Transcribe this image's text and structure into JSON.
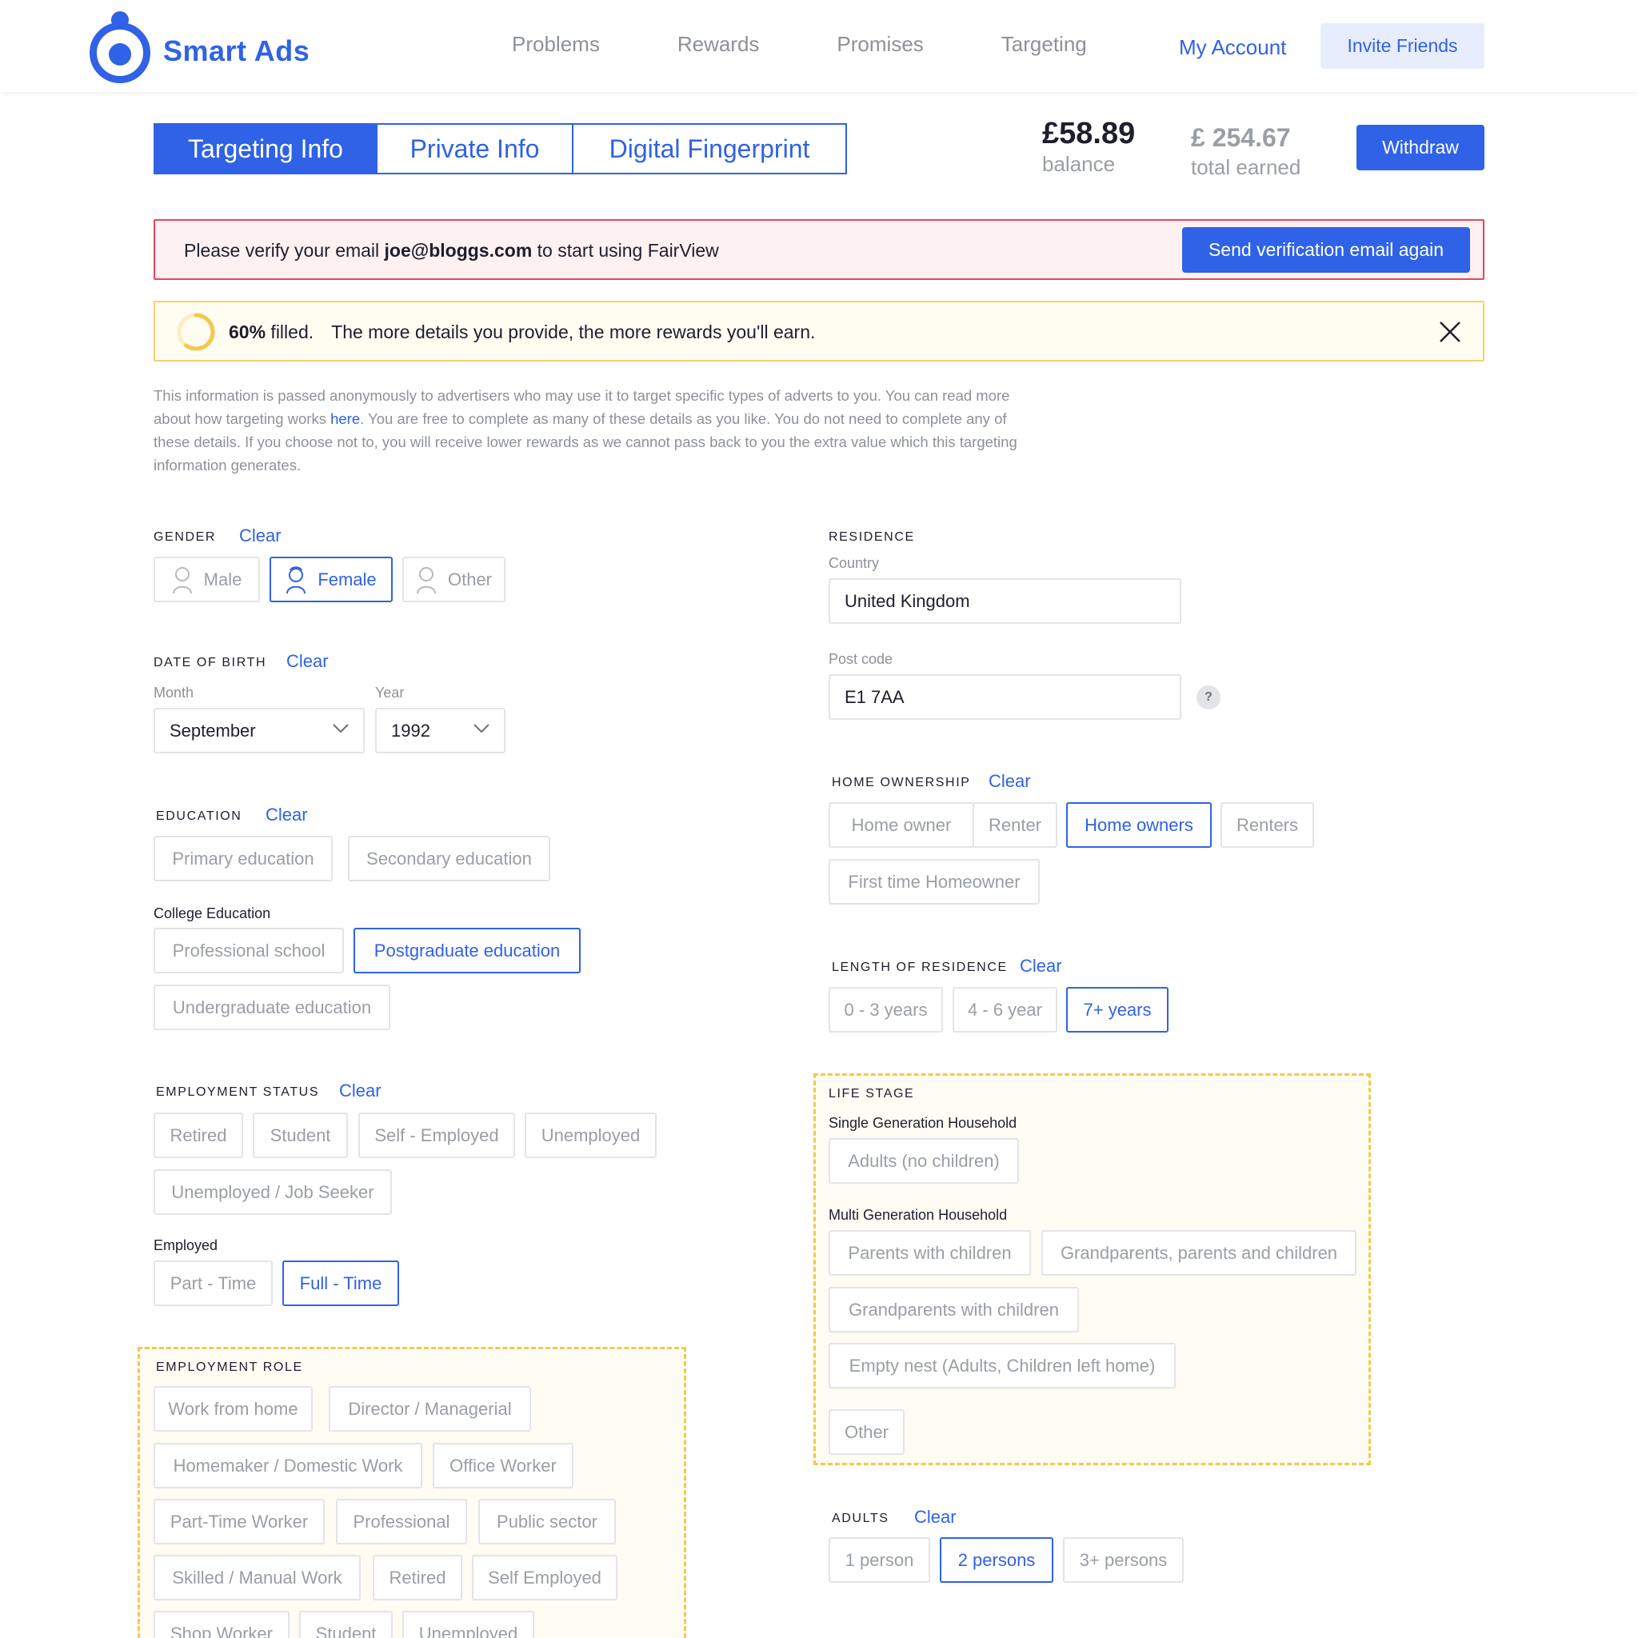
{
  "header": {
    "brand": "Smart Ads",
    "nav": [
      "Problems",
      "Rewards",
      "Promises",
      "Targeting"
    ],
    "my_account": "My Account",
    "invite": "Invite Friends"
  },
  "tabs": [
    "Targeting Info",
    "Private Info",
    "Digital Fingerprint"
  ],
  "account": {
    "balance": "£58.89",
    "balance_label": "balance",
    "earned": "£ 254.67",
    "earned_label": "total earned",
    "withdraw": "Withdraw"
  },
  "verify": {
    "prefix": "Please verify your email ",
    "email": "joe@bloggs.com",
    "suffix": " to start using FairView",
    "button": "Send verification email again"
  },
  "progress": {
    "percent_text": "60%",
    "percent_value": 60,
    "filled": " filled.",
    "message": "The more details you provide, the more rewards you'll earn."
  },
  "intro": {
    "part1": "This information is passed anonymously to advertisers who may use it to target specific types of adverts to you. You can read more about how targeting works ",
    "link": "here",
    "part2": ". You are free to complete as many of these details as you like. You do not need to complete any of these details. If you choose not to, you will receive lower rewards as we cannot pass back to you the extra value which this targeting information generates."
  },
  "clear": "Clear",
  "gender": {
    "title": "Gender",
    "options": [
      "Male",
      "Female",
      "Other"
    ]
  },
  "dob": {
    "title": "Date of birth",
    "month_label": "Month",
    "year_label": "Year",
    "month": "September",
    "year": "1992"
  },
  "education": {
    "title": "Education",
    "options": [
      "Primary education",
      "Secondary education"
    ],
    "college_title": "College Education",
    "college": [
      "Professional school",
      "Postgraduate education",
      "Undergraduate education"
    ]
  },
  "employment": {
    "title": "Employment status",
    "options": [
      "Retired",
      "Student",
      "Self - Employed",
      "Unemployed",
      "Unemployed / Job Seeker"
    ],
    "employed_title": "Employed",
    "employed": [
      "Part - Time",
      "Full - Time"
    ]
  },
  "role": {
    "title": "Employment role",
    "options": [
      "Work from home",
      "Director / Managerial",
      "Homemaker / Domestic Work",
      "Office Worker",
      "Part-Time Worker",
      "Professional",
      "Public sector",
      "Skilled / Manual Work",
      "Retired",
      "Self Employed",
      "Shop Worker",
      "Student",
      "Unemployed"
    ]
  },
  "residence": {
    "title": "Residence",
    "country_label": "Country",
    "country": "United Kingdom",
    "postcode_label": "Post code",
    "postcode": "E1 7AA",
    "help": "?"
  },
  "home": {
    "title": "Home ownership",
    "options": [
      "Home owner",
      "Renter",
      "Home owners",
      "Renters",
      "First time Homeowner"
    ]
  },
  "length": {
    "title": "Length of residence",
    "options": [
      "0 - 3 years",
      "4 - 6 year",
      "7+ years"
    ]
  },
  "life": {
    "title": "Life stage",
    "single_title": "Single Generation Household",
    "single": [
      "Adults (no children)"
    ],
    "multi_title": "Multi Generation Household",
    "multi": [
      "Parents with children",
      "Grandparents, parents and children",
      "Grandparents with children",
      "Empty nest (Adults, Children left home)",
      "Other"
    ]
  },
  "adults": {
    "title": "Adults",
    "options": [
      "1 person",
      "2 persons",
      "3+ persons"
    ]
  },
  "colors": {
    "accent": "#2f62e6",
    "error": "#e6455a",
    "warning": "#f2c94c"
  }
}
